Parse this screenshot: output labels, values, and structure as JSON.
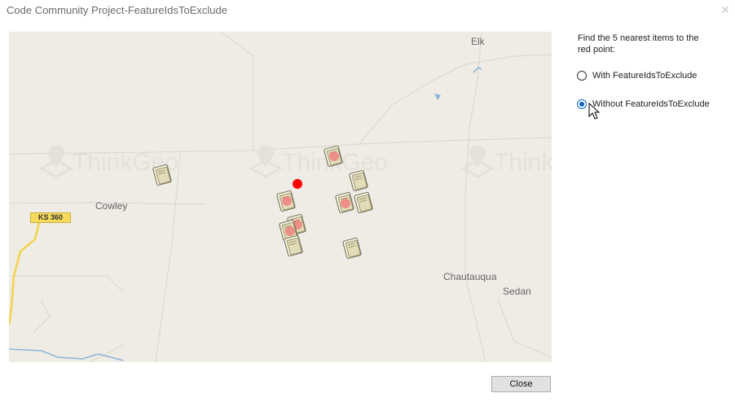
{
  "window": {
    "title": "Code Community Project-FeatureIdsToExclude",
    "close_glyph": "✕"
  },
  "map": {
    "labels": {
      "elk": "Elk",
      "cowley": "Cowley",
      "chautauqua": "Chautauqua",
      "sedan": "Sedan"
    },
    "route_shield": "KS 360",
    "watermark": "ThinkGeo",
    "colors": {
      "background": "#efece6",
      "query_point": "#ff0000",
      "highlight": "#f08080",
      "road_yellow": "#f3d34a",
      "water": "#8fb4d8"
    }
  },
  "panel": {
    "instructions": "Find the 5 nearest items to the red point:",
    "options": [
      {
        "label": "With FeatureIdsToExclude",
        "checked": false
      },
      {
        "label": "Without FeatureIdsToExclude",
        "checked": true
      }
    ]
  },
  "footer": {
    "close_label": "Close"
  }
}
